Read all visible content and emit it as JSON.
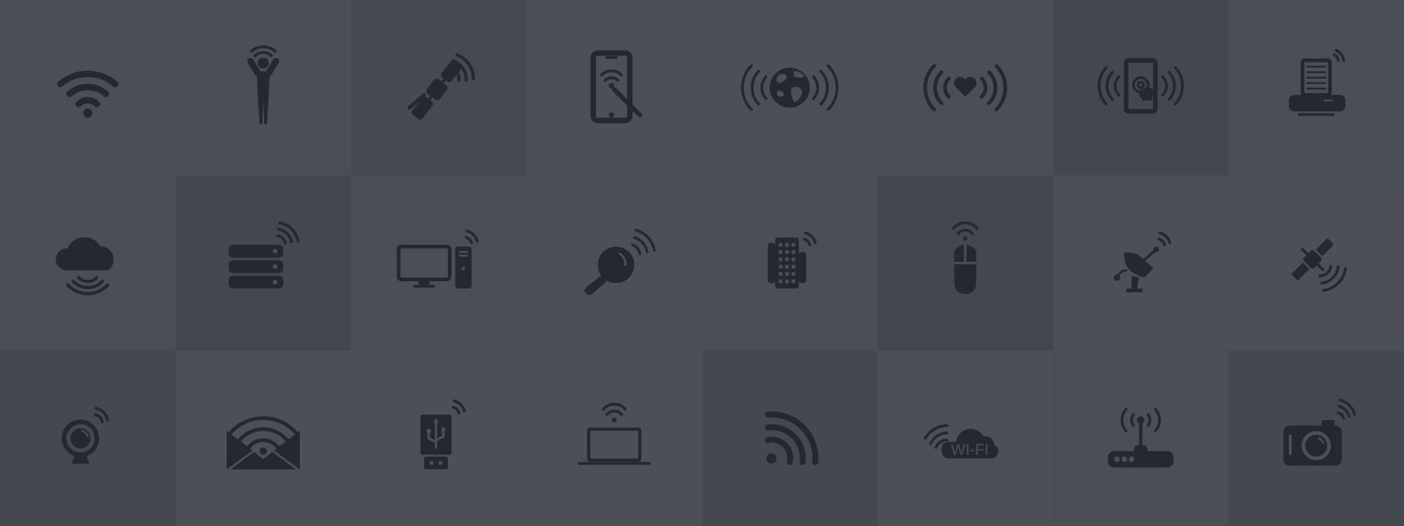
{
  "colors": {
    "icon": "#25282e",
    "tile_shades": [
      [
        "#4b4e55",
        "#4a4e55",
        "#454a51",
        "#4c4f56",
        "#4b4f56",
        "#4b4e55",
        "#434850",
        "#4a4e55"
      ],
      [
        "#4b4e55",
        "#434850",
        "#4b4e55",
        "#4c4f56",
        "#4b4e55",
        "#434850",
        "#4b4f56",
        "#4c4f56"
      ],
      [
        "#444950",
        "#4b4f56",
        "#4c4f56",
        "#4b4f56",
        "#444950",
        "#4c4f56",
        "#4a4e55",
        "#444950"
      ]
    ]
  },
  "icons": [
    "wifi-icon",
    "person-wireless-icon",
    "satellite-signal-icon",
    "tablet-wifi-stylus-icon",
    "globe-signal-icon",
    "heart-signal-icon",
    "tablet-touch-signal-icon",
    "fax-machine-wifi-icon",
    "cloud-signal-icon",
    "server-stack-wifi-icon",
    "desktop-computer-wifi-icon",
    "magnifier-wifi-icon",
    "phone-keypad-wifi-icon",
    "mouse-wifi-icon",
    "satellite-dish-wifi-icon",
    "satellite-waves-icon",
    "webcam-wifi-icon",
    "envelope-wifi-icon",
    "usb-drive-wifi-icon",
    "laptop-wifi-icon",
    "rss-feed-icon",
    "wifi-cloud-icon",
    "router-icon",
    "camera-wifi-icon"
  ],
  "labels": {
    "wifi_cloud": "WI-FI"
  }
}
